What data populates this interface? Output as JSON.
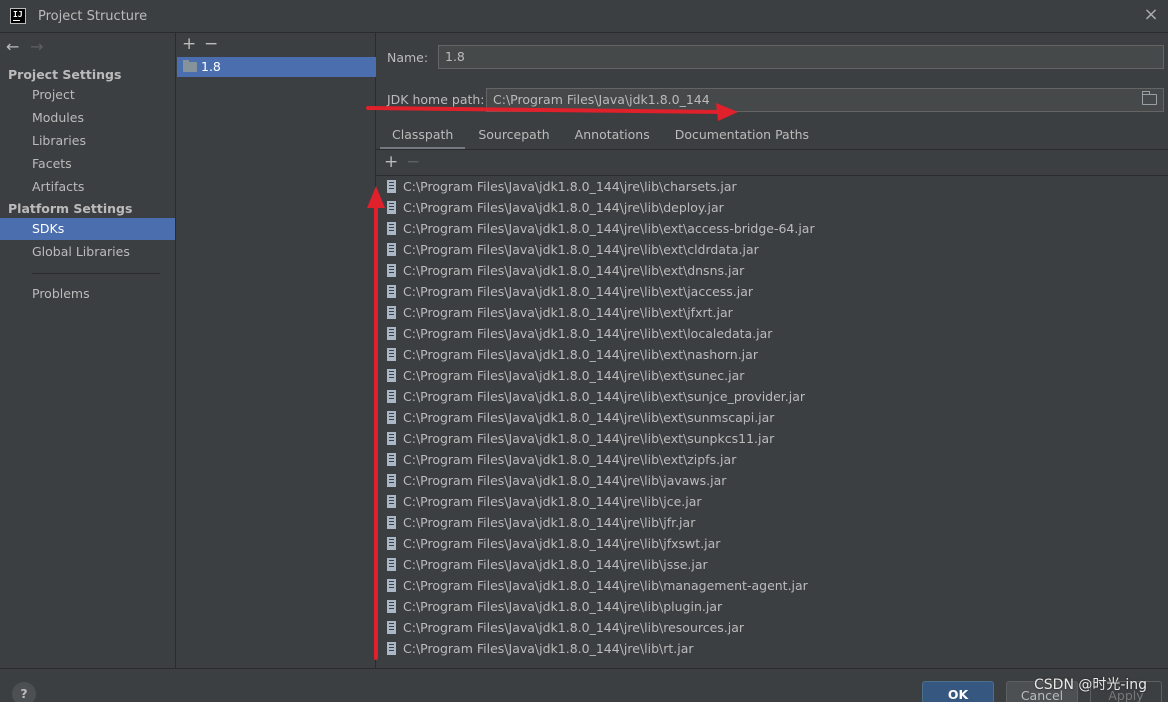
{
  "window": {
    "title": "Project Structure",
    "logo_text": "IJ",
    "close_glyph": "×"
  },
  "left_nav": {
    "back_glyph": "←",
    "forward_glyph": "→",
    "project_settings_header": "Project Settings",
    "project_settings_items": [
      "Project",
      "Modules",
      "Libraries",
      "Facets",
      "Artifacts"
    ],
    "platform_settings_header": "Platform Settings",
    "platform_settings_items": [
      "SDKs",
      "Global Libraries"
    ],
    "selected_item": "SDKs",
    "other_items": [
      "Problems"
    ]
  },
  "sdk_list": {
    "add_glyph": "+",
    "remove_glyph": "−",
    "items": [
      "1.8"
    ],
    "selected": "1.8"
  },
  "sdk_details": {
    "name_label": "Name:",
    "name_value": "1.8",
    "jdk_home_label": "JDK home path:",
    "jdk_home_value": "C:\\Program Files\\Java\\jdk1.8.0_144",
    "tabs": [
      "Classpath",
      "Sourcepath",
      "Annotations",
      "Documentation Paths"
    ],
    "active_tab": "Classpath",
    "classpath_add_glyph": "+",
    "classpath_remove_glyph": "−",
    "classpath_entries": [
      "C:\\Program Files\\Java\\jdk1.8.0_144\\jre\\lib\\charsets.jar",
      "C:\\Program Files\\Java\\jdk1.8.0_144\\jre\\lib\\deploy.jar",
      "C:\\Program Files\\Java\\jdk1.8.0_144\\jre\\lib\\ext\\access-bridge-64.jar",
      "C:\\Program Files\\Java\\jdk1.8.0_144\\jre\\lib\\ext\\cldrdata.jar",
      "C:\\Program Files\\Java\\jdk1.8.0_144\\jre\\lib\\ext\\dnsns.jar",
      "C:\\Program Files\\Java\\jdk1.8.0_144\\jre\\lib\\ext\\jaccess.jar",
      "C:\\Program Files\\Java\\jdk1.8.0_144\\jre\\lib\\ext\\jfxrt.jar",
      "C:\\Program Files\\Java\\jdk1.8.0_144\\jre\\lib\\ext\\localedata.jar",
      "C:\\Program Files\\Java\\jdk1.8.0_144\\jre\\lib\\ext\\nashorn.jar",
      "C:\\Program Files\\Java\\jdk1.8.0_144\\jre\\lib\\ext\\sunec.jar",
      "C:\\Program Files\\Java\\jdk1.8.0_144\\jre\\lib\\ext\\sunjce_provider.jar",
      "C:\\Program Files\\Java\\jdk1.8.0_144\\jre\\lib\\ext\\sunmscapi.jar",
      "C:\\Program Files\\Java\\jdk1.8.0_144\\jre\\lib\\ext\\sunpkcs11.jar",
      "C:\\Program Files\\Java\\jdk1.8.0_144\\jre\\lib\\ext\\zipfs.jar",
      "C:\\Program Files\\Java\\jdk1.8.0_144\\jre\\lib\\javaws.jar",
      "C:\\Program Files\\Java\\jdk1.8.0_144\\jre\\lib\\jce.jar",
      "C:\\Program Files\\Java\\jdk1.8.0_144\\jre\\lib\\jfr.jar",
      "C:\\Program Files\\Java\\jdk1.8.0_144\\jre\\lib\\jfxswt.jar",
      "C:\\Program Files\\Java\\jdk1.8.0_144\\jre\\lib\\jsse.jar",
      "C:\\Program Files\\Java\\jdk1.8.0_144\\jre\\lib\\management-agent.jar",
      "C:\\Program Files\\Java\\jdk1.8.0_144\\jre\\lib\\plugin.jar",
      "C:\\Program Files\\Java\\jdk1.8.0_144\\jre\\lib\\resources.jar",
      "C:\\Program Files\\Java\\jdk1.8.0_144\\jre\\lib\\rt.jar"
    ]
  },
  "footer": {
    "help_glyph": "?",
    "ok_label": "OK",
    "cancel_label": "Cancel",
    "apply_label": "Apply"
  },
  "watermark": "CSDN @时光-ing",
  "colors": {
    "background": "#3c3f41",
    "selection": "#4b6eaf",
    "ok_button": "#365880",
    "annotation_arrow": "#e0202a"
  },
  "icons": {
    "sdk_item": "folder-icon",
    "jdk_home_browse": "folder-open-icon",
    "classpath_entry": "jar-archive-icon"
  }
}
